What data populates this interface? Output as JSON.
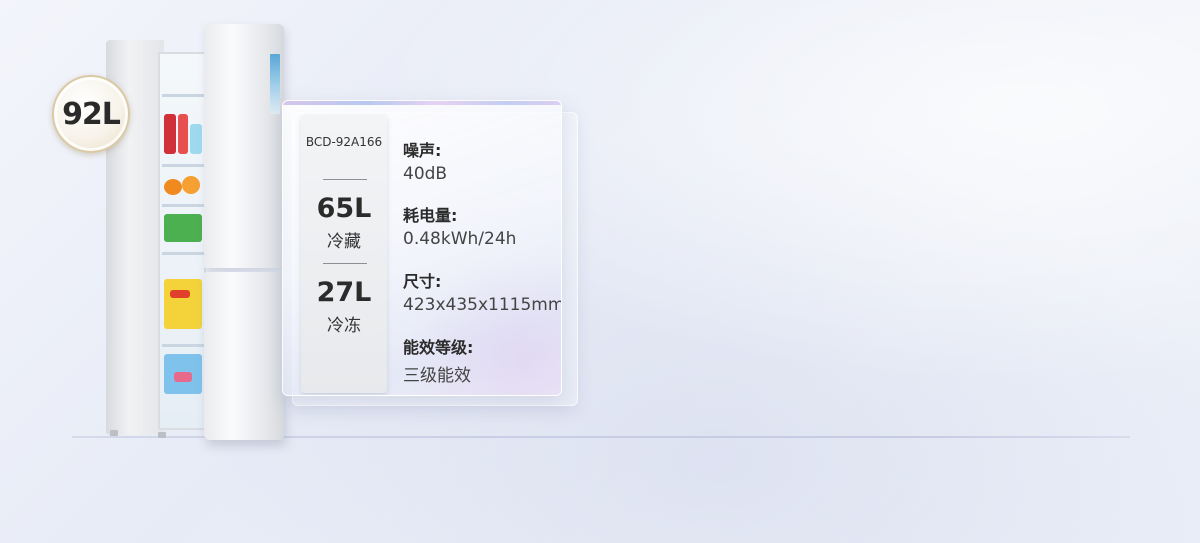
{
  "badge": {
    "capacity": "92L"
  },
  "card": {
    "model": "BCD-92A166",
    "fridge": {
      "volume": "65L",
      "label": "冷藏"
    },
    "freezer": {
      "volume": "27L",
      "label": "冷冻"
    },
    "specs": [
      {
        "label": "噪声:",
        "value": "40dB"
      },
      {
        "label": "耗电量:",
        "value": "0.48kWh/24h"
      },
      {
        "label": "尺寸:",
        "value": "423x435x1115mm"
      },
      {
        "label": "能效等级:",
        "value": "三级能效"
      }
    ]
  },
  "colors": {
    "background": "#eceff8",
    "badge_ring": "#d9c9a4",
    "text_dark": "#2b2b2b"
  }
}
